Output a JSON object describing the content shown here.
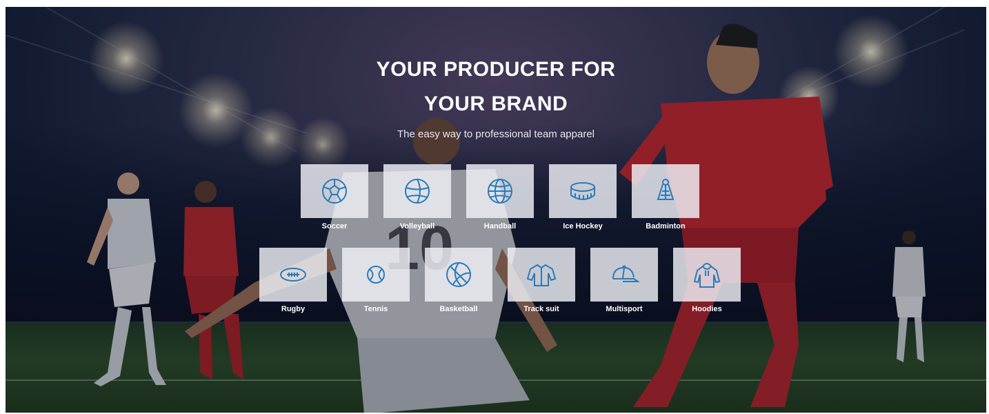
{
  "hero": {
    "title_line1": "YOUR PRODUCER FOR",
    "title_line2": "YOUR BRAND",
    "tagline": "The easy way to professional team apparel",
    "icon_color": "#2a7ab8"
  },
  "sports": [
    {
      "label": "Soccer",
      "icon": "soccer-ball-icon"
    },
    {
      "label": "Volleyball",
      "icon": "volleyball-icon"
    },
    {
      "label": "Handball",
      "icon": "handball-icon"
    },
    {
      "label": "Ice Hockey",
      "icon": "hockey-puck-icon"
    },
    {
      "label": "Badminton",
      "icon": "shuttlecock-icon"
    },
    {
      "label": "Rugby",
      "icon": "rugby-ball-icon"
    },
    {
      "label": "Tennis",
      "icon": "tennis-ball-icon"
    },
    {
      "label": "Basketball",
      "icon": "basketball-icon"
    },
    {
      "label": "Track suit",
      "icon": "track-suit-icon"
    },
    {
      "label": "Multisport",
      "icon": "cap-icon"
    },
    {
      "label": "Hoodies",
      "icon": "hoodie-icon"
    }
  ]
}
